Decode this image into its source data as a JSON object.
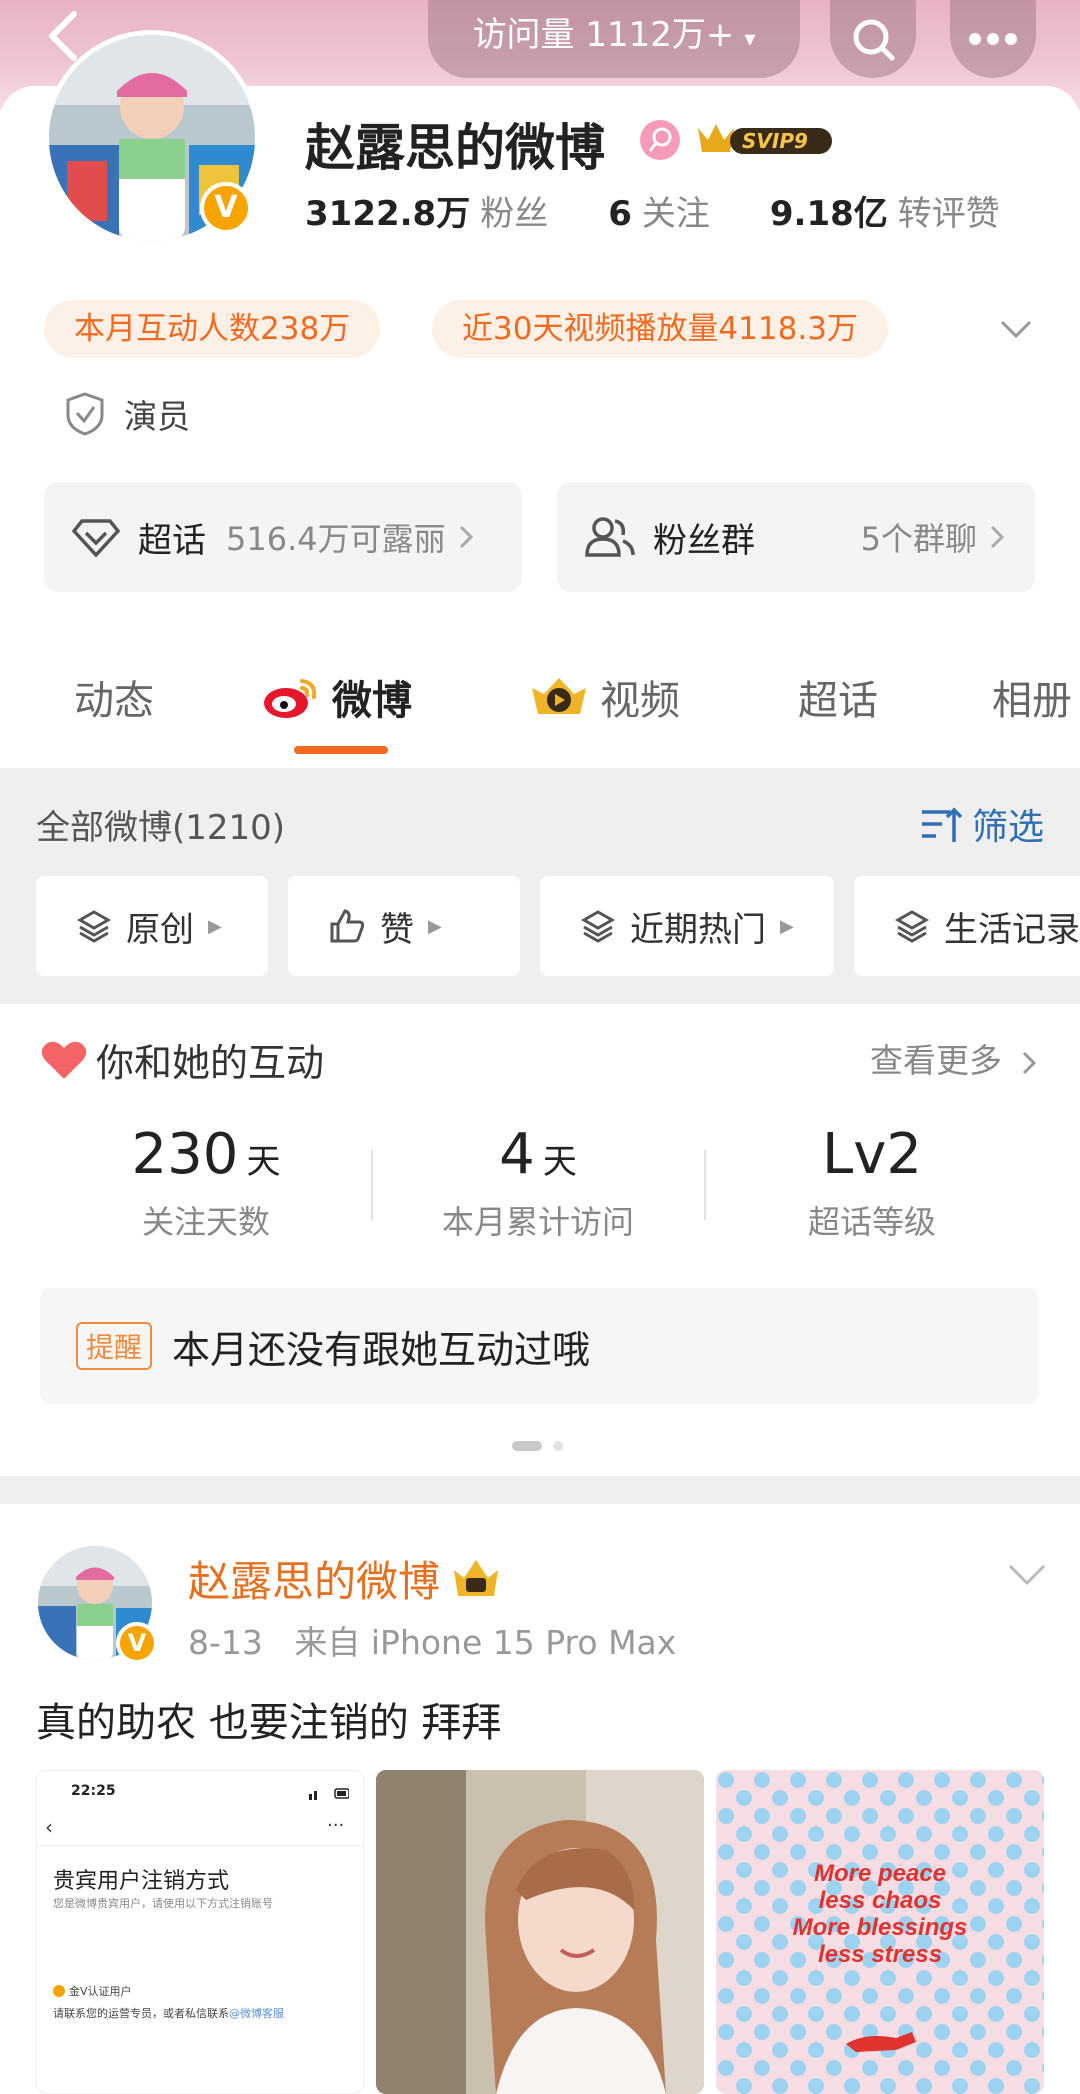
{
  "header": {
    "visits_label": "访问量 1112万+",
    "caret": "▾"
  },
  "profile": {
    "name": "赵露思的微博",
    "svip": "SVIP9",
    "verify_mark": "V",
    "stats": [
      {
        "value": "3122.8万",
        "label": "粉丝"
      },
      {
        "value": "6",
        "label": "关注"
      },
      {
        "value": "9.18亿",
        "label": "转评赞"
      }
    ],
    "pills": [
      "本月互动人数238万",
      "近30天视频播放量4118.3万"
    ],
    "tag": "演员",
    "shortcuts": [
      {
        "title": "超话",
        "sub": "516.4万可露丽"
      },
      {
        "title": "粉丝群",
        "sub": "5个群聊"
      }
    ]
  },
  "tabs": [
    "动态",
    "微博",
    "视频",
    "超话",
    "相册"
  ],
  "active_tab": "微博",
  "feed": {
    "all_label": "全部微博(1210)",
    "filter_label": "筛选",
    "chips": [
      "原创",
      "赞",
      "近期热门",
      "生活记录"
    ]
  },
  "interaction": {
    "title": "你和她的互动",
    "see_more": "查看更多",
    "metrics": [
      {
        "num": "230",
        "unit": "天",
        "label": "关注天数"
      },
      {
        "num": "4",
        "unit": "天",
        "label": "本月累计访问"
      },
      {
        "num": "Lv2",
        "unit": "",
        "label": "超话等级"
      }
    ],
    "remind_badge": "提醒",
    "remind_text": "本月还没有跟她互动过哦"
  },
  "post": {
    "author": "赵露思的微博",
    "date": "8-13",
    "source": "来自 iPhone 15 Pro Max",
    "text": "真的助农 也要注销的 拜拜",
    "thumb1": {
      "time": "22:25",
      "title": "贵宾用户注销方式",
      "sub": "您是微博贵宾用户，请使用以下方式注销账号",
      "gold_v": "金V认证用户",
      "contact": "请联系您的运营专员，或者私信联系",
      "link": "@微博客服"
    },
    "thumb3": {
      "lines": [
        "More peace",
        "less chaos",
        "More blessings",
        "less stress"
      ]
    }
  },
  "colors": {
    "accent": "#f26a20",
    "link": "#2f6fb5",
    "header_pink": "#e8b2c6"
  }
}
